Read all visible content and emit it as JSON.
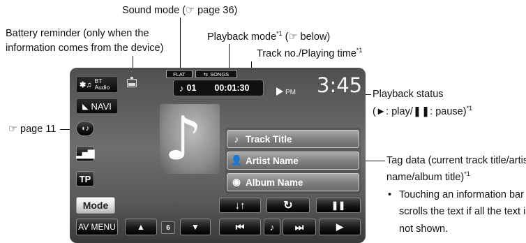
{
  "callouts": {
    "sound_mode": "Sound mode (☞ page 36)",
    "battery_line1": "Battery reminder (only when the",
    "battery_line2": "information comes from the device)",
    "playback_mode": "Playback mode",
    "playback_mode_ref": " (☞ below)",
    "track_time": "Track no./Playing time",
    "playback_status_line1": "Playback status",
    "playback_status_line2": "(►: play/❚❚: pause)",
    "page_ref": "☞ page 11",
    "tag_line1": "Tag data (current track title/artist",
    "tag_line2": "name/album title)",
    "note_line1": "Touching an information bar",
    "note_line2": "scrolls the text if all the text is",
    "note_line3": "not shown.",
    "footnote_mark": "*1",
    "bullet": "•"
  },
  "screen": {
    "source_line1": "BT",
    "source_line2": "Audio",
    "navi": "NAVI",
    "sound_badge": "FLAT",
    "repeat_badge": "SONGS",
    "track_no": "01",
    "play_time": "00:01:30",
    "clock_ampm": "PM",
    "clock_time": "3:45",
    "tp_label": "TP",
    "mode_label": "Mode",
    "av_menu_label": "AV MENU",
    "page_number": "6",
    "track_title": "Track Title",
    "artist_name": "Artist Name",
    "album_name": "Album Name"
  },
  "icons": [
    "bt-audio-icon",
    "battery-icon",
    "navi-arrow-icon",
    "sound-icon",
    "equalizer-icon",
    "music-note-icon",
    "person-icon",
    "disc-icon",
    "shuffle-icon",
    "repeat-icon",
    "pause-icon",
    "up-arrow-icon",
    "down-arrow-icon",
    "previous-icon",
    "next-icon",
    "play-icon",
    "play-status-icon"
  ]
}
